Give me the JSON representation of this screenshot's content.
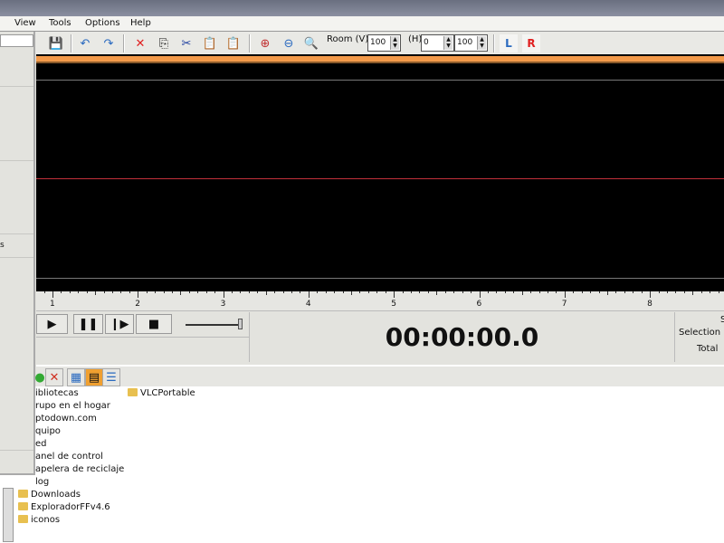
{
  "menubar": {
    "items": [
      {
        "label": "View"
      },
      {
        "label": "Tools"
      },
      {
        "label": "Options"
      },
      {
        "label": "Help"
      }
    ]
  },
  "toolbar": {
    "room_v_label": "Room (V)",
    "room_v_value": "100",
    "h_label": "(H)",
    "h_start": "0",
    "h_end": "100",
    "left_channel": "L",
    "right_channel": "R"
  },
  "ruler": {
    "labels": [
      "1",
      "2",
      "3",
      "4",
      "5",
      "6",
      "7",
      "8"
    ]
  },
  "transport": {
    "time": "00:00:00.0",
    "volume_level": 1.0
  },
  "selection": {
    "col_header": "S",
    "selection_label": "Selection",
    "total_label": "Total"
  },
  "dropdown_menu": {
    "visible_text": "s"
  },
  "files": {
    "items": [
      "ibliotecas",
      "rupo en el hogar",
      "ptodown.com",
      "quipo",
      "ed",
      "anel de control",
      "apelera de reciclaje",
      "log",
      "Downloads",
      "ExploradorFFv4.6",
      "iconos"
    ],
    "right_items": [
      "VLCPortable"
    ]
  },
  "colors": {
    "waveform_bg": "#000000",
    "timeline_band": "#f39a4a",
    "center_line": "#c0303a"
  }
}
